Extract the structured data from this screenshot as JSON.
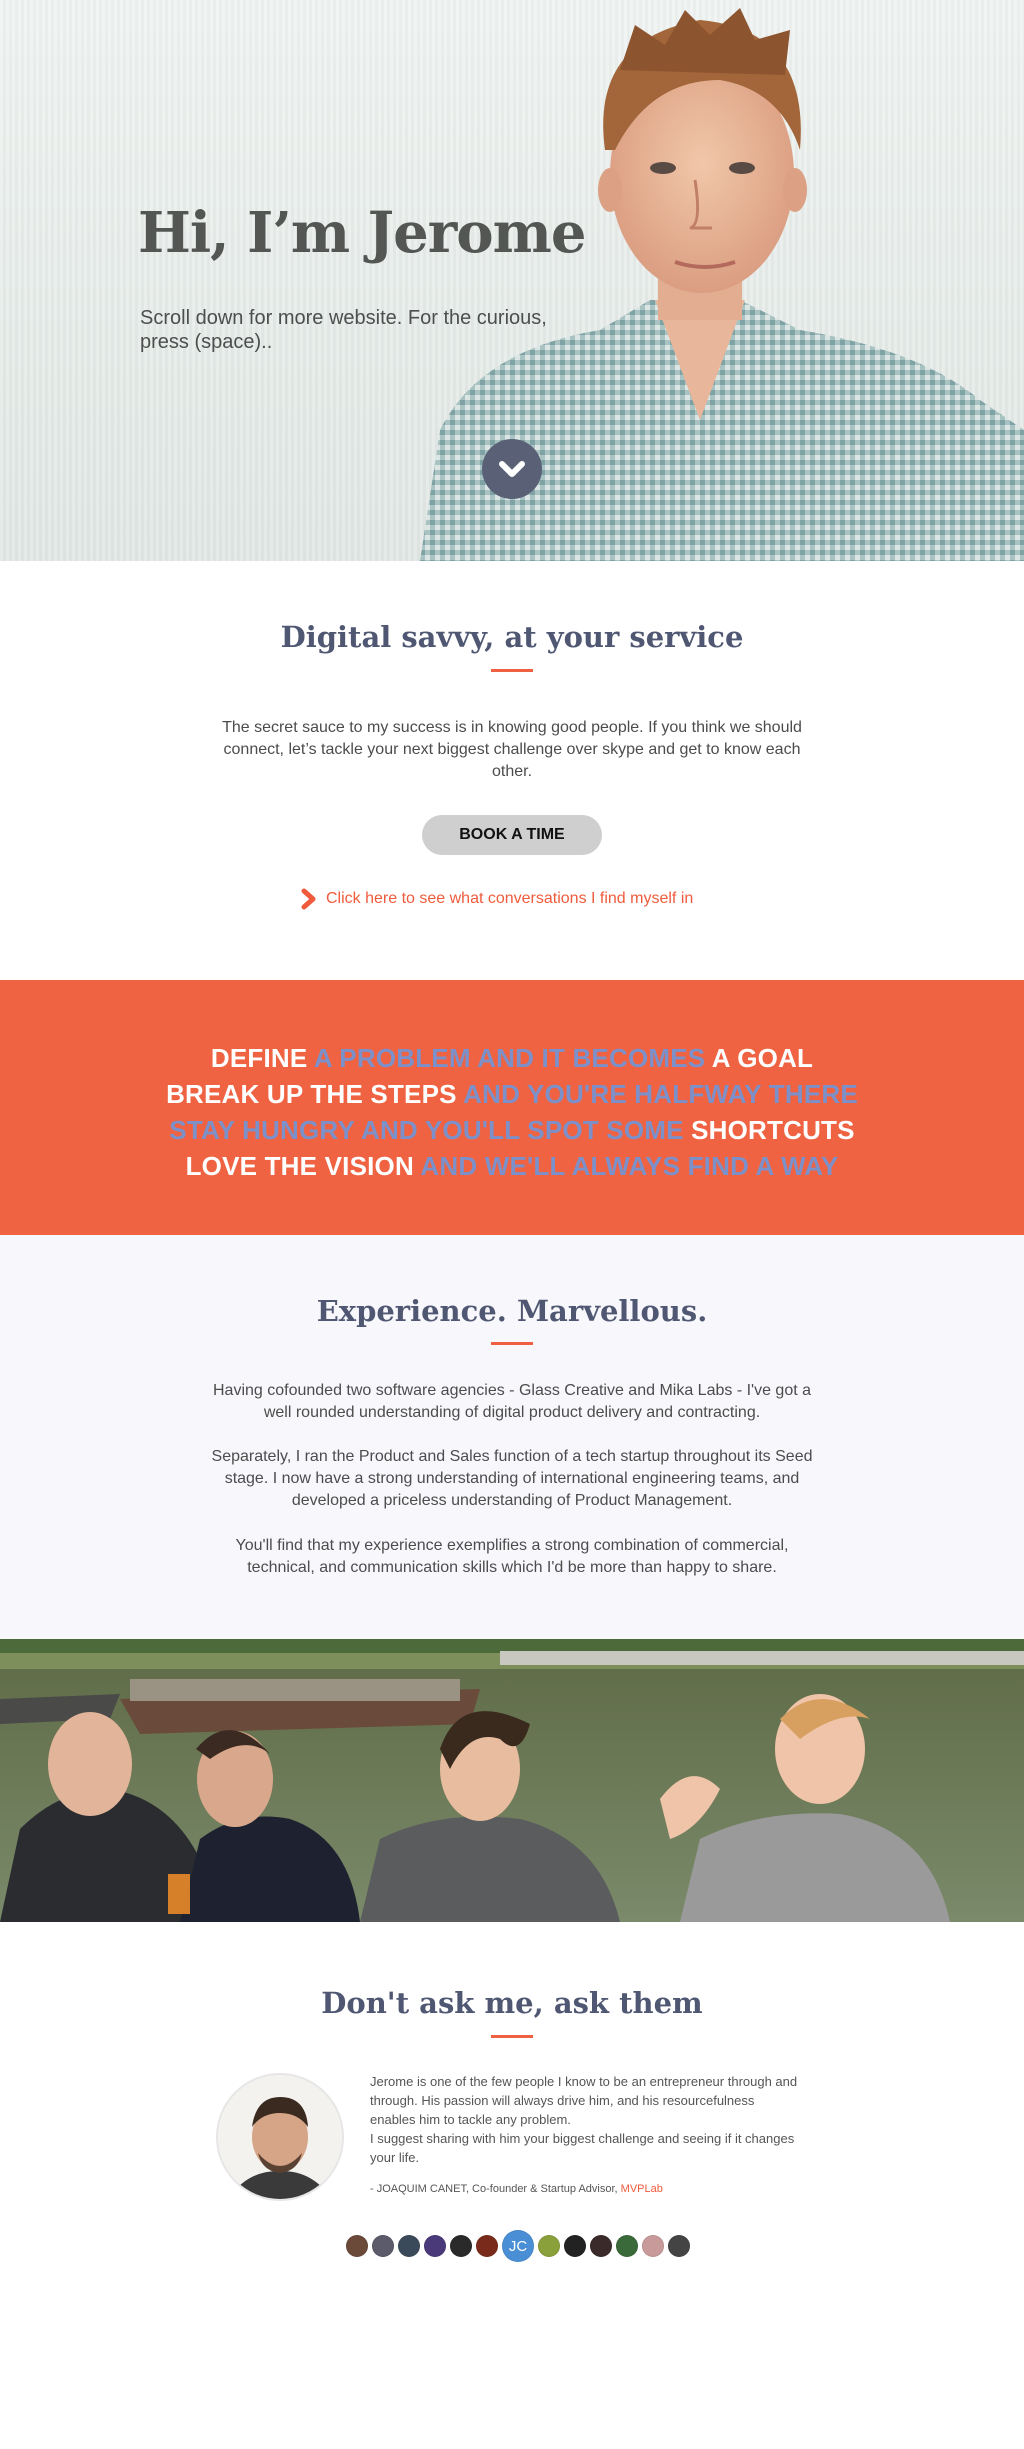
{
  "hero": {
    "title": "Hi, I’m Jerome",
    "subtitle": "Scroll down for more website. For the curious, press (space)..",
    "scroll_icon": "chevron-down-icon"
  },
  "service": {
    "title": "Digital savvy, at your service",
    "body": "The secret sauce to my success is in knowing good people. If you think we should connect, let’s tackle your next biggest challenge over skype and get to know each other.",
    "book_label": "BOOK A TIME",
    "link_text": "Click here to see what conversations I find myself in",
    "link_icon": "chevron-right-icon"
  },
  "motto": {
    "lines": [
      [
        {
          "t": "DEFINE ",
          "c": "w"
        },
        {
          "t": "A PROBLEM AND IT BECOMES ",
          "c": "b"
        },
        {
          "t": "A GOAL",
          "c": "w"
        }
      ],
      [
        {
          "t": "BREAK UP THE STEPS ",
          "c": "w"
        },
        {
          "t": "AND YOU'RE HALFWAY THERE",
          "c": "b"
        }
      ],
      [
        {
          "t": "STAY HUNGRY AND YOU'LL SPOT SOME ",
          "c": "b"
        },
        {
          "t": "SHORTCUTS",
          "c": "w"
        }
      ],
      [
        {
          "t": "LOVE THE VISION ",
          "c": "w"
        },
        {
          "t": "AND WE'LL ALWAYS FIND A WAY",
          "c": "b"
        }
      ]
    ]
  },
  "experience": {
    "title": "Experience. Marvellous.",
    "p1": "Having cofounded two software agencies - Glass Creative and Mika Labs - I've got a well rounded understanding of digital product delivery and contracting.",
    "p2": "Separately, I ran the Product and Sales function of a tech startup throughout its Seed stage. I now have a strong understanding of international engineering teams, and developed a priceless understanding of Product Management.",
    "p3": "You'll find that my experience exemplifies a strong combination of commercial, technical, and communication skills which I'd be more than happy to share."
  },
  "testimonials": {
    "title": "Don't ask me, ask them",
    "quote_1": "Jerome is one of the few people I know to be an entrepreneur through and through. His passion will always drive him, and his resourcefulness enables him to tackle any problem.",
    "quote_2": "I suggest sharing with him your biggest challenge and seeing if it changes your life.",
    "author": "- JOAQUIM CANET, Co-founder & Startup Advisor, ",
    "author_org": "MVPLab",
    "selected_initials": "JC",
    "avatar_colors": [
      "#6b4a3a",
      "#5b5b6b",
      "#3b4a5a",
      "#4b3a7a",
      "#2a2a2a",
      "#7a2a1a",
      "#4a8fd6",
      "#8aa03a",
      "#222222",
      "#3a2a2a",
      "#3a6a3a",
      "#c89a9a",
      "#444444"
    ]
  },
  "colors": {
    "accent": "#ef6342",
    "heading": "#4f5772",
    "band_blue": "#7c90c9"
  }
}
